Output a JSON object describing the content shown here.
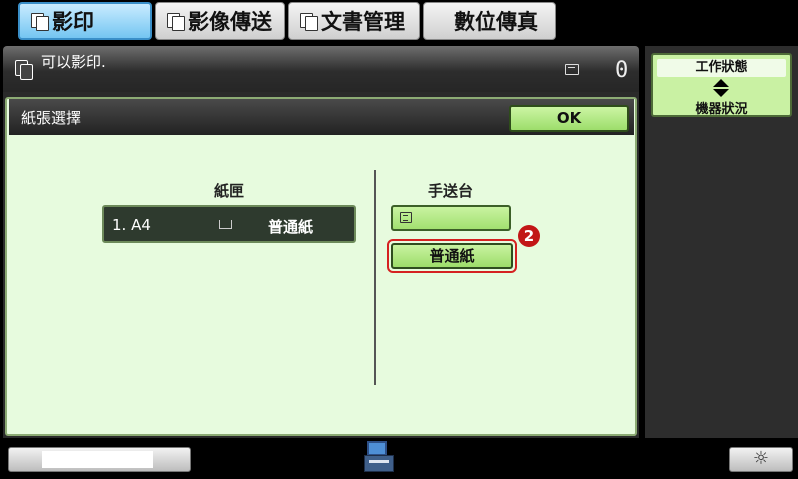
{
  "tabs": [
    {
      "label": "影印",
      "active": true
    },
    {
      "label": "影像傳送",
      "active": false
    },
    {
      "label": "文書管理",
      "active": false
    },
    {
      "label": "數位傳真",
      "active": false
    }
  ],
  "status": {
    "message": "可以影印.",
    "queue_count": "0"
  },
  "job_status": {
    "top_label": "工作狀態",
    "bottom_label": "機器狀況"
  },
  "panel": {
    "title": "紙張選擇",
    "ok_label": "OK",
    "tray_column_label": "紙匣",
    "tray": {
      "number_size": "1. A4",
      "type": "普通紙"
    },
    "bypass_column_label": "手送台",
    "bypass_paper_type": "普通紙",
    "step_marker": "2"
  },
  "colors": {
    "panel_background": "#e7fbde",
    "button_green": "#a2e070",
    "highlight_red": "#d52121",
    "active_tab_blue": "#74c5f1"
  },
  "icons": {
    "copy": "copy-icon",
    "queue": "job-queue-icon",
    "tray": "paper-tray-icon",
    "bypass": "bypass-tray-icon",
    "device": "device-icon",
    "brightness": "brightness-icon"
  }
}
